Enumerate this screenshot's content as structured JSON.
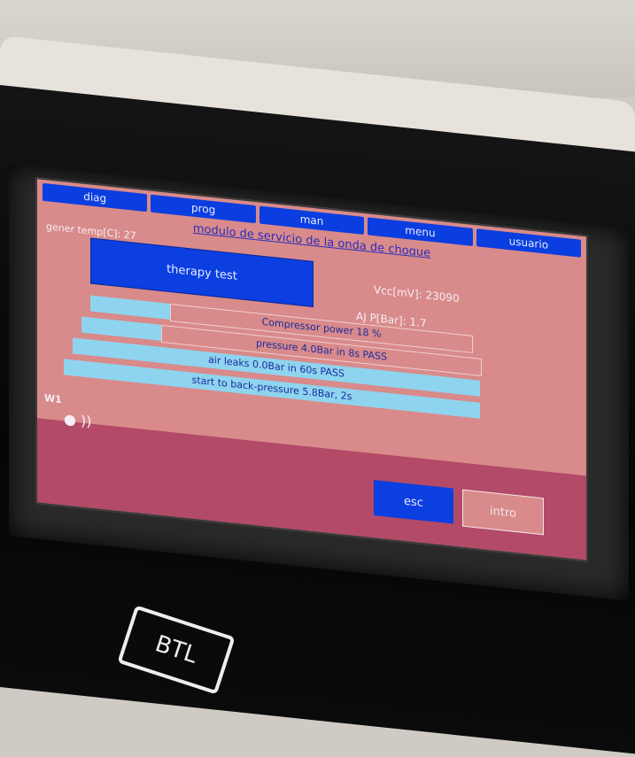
{
  "tabs": [
    "diag",
    "prog",
    "man",
    "menu",
    "usuario"
  ],
  "title": "modulo de servicio de la onda de choque",
  "labels": {
    "gener_temp": "gener temp[C]: 27",
    "vcc": "Vcc[mV]: 23090",
    "aj_p": "AJ P[Bar]: 1.7",
    "w1": "W1"
  },
  "buttons": {
    "therapy": "therapy test",
    "esc": "esc",
    "intro": "intro"
  },
  "rows": [
    "Compressor power 18 %",
    "pressure 4.0Bar in 8s PASS",
    "air leaks 0.0Bar in 60s PASS",
    "start to back-pressure 5.8Bar, 2s"
  ],
  "logo": "BTL",
  "colors": {
    "screen_bg": "#d98a8a",
    "button_blue": "#0b3fe0",
    "cyan": "#8fd4ee",
    "bottom_bar": "#b24a68"
  }
}
